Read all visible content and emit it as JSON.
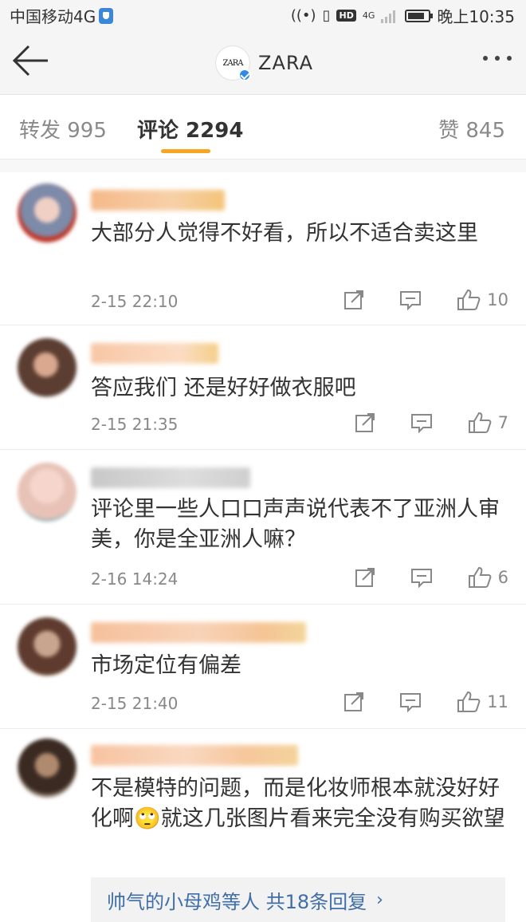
{
  "status_bar": {
    "carrier": "中国移动4G",
    "time": "晚上10:35",
    "hd": "HD",
    "network": "4G",
    "battery_level": 0.85,
    "icons": [
      "shield-icon",
      "nfc-icon",
      "vibrate-icon",
      "signal-icon",
      "battery-icon"
    ]
  },
  "header": {
    "title": "ZARA",
    "avatar_text": "ZARA"
  },
  "tabs": {
    "repost": "转发 995",
    "comments": "评论 2294",
    "likes": "赞 845",
    "active_color": "#f6a623"
  },
  "comments": [
    {
      "text": "大部分人觉得不好看，所以不适合卖这里",
      "time": "2-15 22:10",
      "likes": "10"
    },
    {
      "text": "答应我们 还是好好做衣服吧",
      "time": "2-15 21:35",
      "likes": "7"
    },
    {
      "text": "评论里一些人口口声声说代表不了亚洲人审美，你是全亚洲人嘛？",
      "time": "2-16 14:24",
      "likes": "6"
    },
    {
      "text": "市场定位有偏差",
      "time": "2-15 21:40",
      "likes": "11"
    },
    {
      "text": "不是模特的问题，而是化妆师根本就没好好化啊🙄就这几张图片看来完全没有购买欲望",
      "time": "",
      "likes": ""
    }
  ],
  "reply": {
    "text": "帅气的小母鸡等人  共18条回复",
    "chevron": "›"
  },
  "colors": {
    "link": "#3f6ea8",
    "meta": "#888888",
    "accent": "#f6a623"
  }
}
